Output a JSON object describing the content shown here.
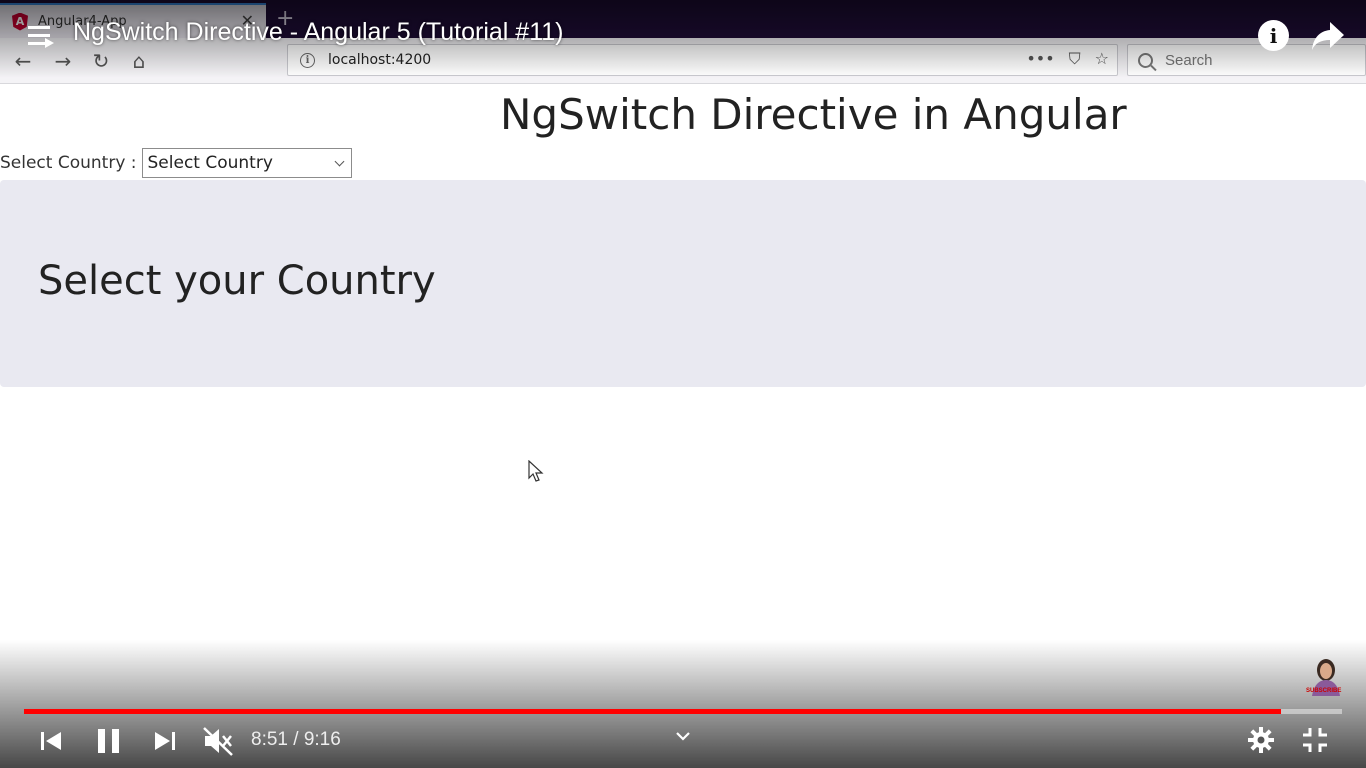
{
  "browser": {
    "tab_title": "Angular4-App",
    "url": "localhost:4200",
    "search_placeholder": "Search"
  },
  "video": {
    "title": "NgSwitch Directive - Angular 5 (Tutorial #11)",
    "current_time": "8:51",
    "separator": "/",
    "duration": "9:16",
    "progress_fraction": 0.954,
    "subscribe_label": "SUBSCRIBE"
  },
  "page": {
    "heading": "NgSwitch Directive in Angular",
    "country_label": "Select Country :",
    "country_select_value": "Select Country",
    "jumbotron_text": "Select your Country"
  },
  "colors": {
    "progress": "#ff0000",
    "jumbotron_bg": "#e9e9f1",
    "tab_strip": "#1e0d36"
  }
}
